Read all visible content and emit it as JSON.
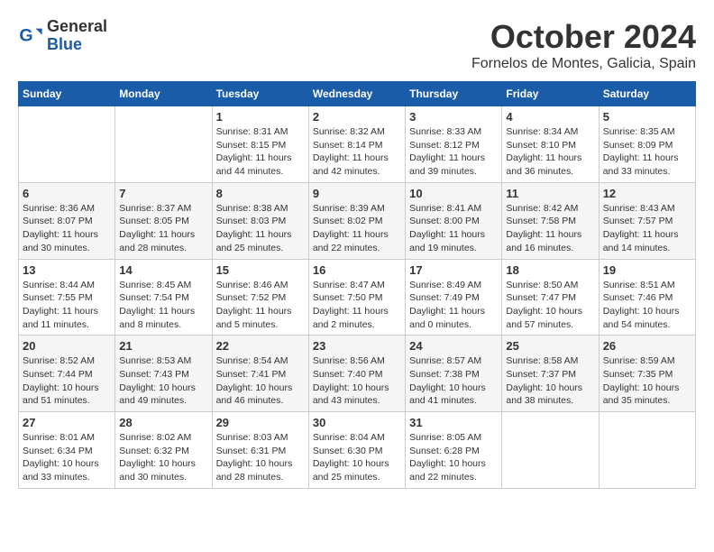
{
  "header": {
    "logo_general": "General",
    "logo_blue": "Blue",
    "month": "October 2024",
    "location": "Fornelos de Montes, Galicia, Spain"
  },
  "weekdays": [
    "Sunday",
    "Monday",
    "Tuesday",
    "Wednesday",
    "Thursday",
    "Friday",
    "Saturday"
  ],
  "weeks": [
    [
      null,
      null,
      {
        "day": 1,
        "sunrise": "8:31 AM",
        "sunset": "8:15 PM",
        "daylight": "11 hours and 44 minutes."
      },
      {
        "day": 2,
        "sunrise": "8:32 AM",
        "sunset": "8:14 PM",
        "daylight": "11 hours and 42 minutes."
      },
      {
        "day": 3,
        "sunrise": "8:33 AM",
        "sunset": "8:12 PM",
        "daylight": "11 hours and 39 minutes."
      },
      {
        "day": 4,
        "sunrise": "8:34 AM",
        "sunset": "8:10 PM",
        "daylight": "11 hours and 36 minutes."
      },
      {
        "day": 5,
        "sunrise": "8:35 AM",
        "sunset": "8:09 PM",
        "daylight": "11 hours and 33 minutes."
      }
    ],
    [
      {
        "day": 6,
        "sunrise": "8:36 AM",
        "sunset": "8:07 PM",
        "daylight": "11 hours and 30 minutes."
      },
      {
        "day": 7,
        "sunrise": "8:37 AM",
        "sunset": "8:05 PM",
        "daylight": "11 hours and 28 minutes."
      },
      {
        "day": 8,
        "sunrise": "8:38 AM",
        "sunset": "8:03 PM",
        "daylight": "11 hours and 25 minutes."
      },
      {
        "day": 9,
        "sunrise": "8:39 AM",
        "sunset": "8:02 PM",
        "daylight": "11 hours and 22 minutes."
      },
      {
        "day": 10,
        "sunrise": "8:41 AM",
        "sunset": "8:00 PM",
        "daylight": "11 hours and 19 minutes."
      },
      {
        "day": 11,
        "sunrise": "8:42 AM",
        "sunset": "7:58 PM",
        "daylight": "11 hours and 16 minutes."
      },
      {
        "day": 12,
        "sunrise": "8:43 AM",
        "sunset": "7:57 PM",
        "daylight": "11 hours and 14 minutes."
      }
    ],
    [
      {
        "day": 13,
        "sunrise": "8:44 AM",
        "sunset": "7:55 PM",
        "daylight": "11 hours and 11 minutes."
      },
      {
        "day": 14,
        "sunrise": "8:45 AM",
        "sunset": "7:54 PM",
        "daylight": "11 hours and 8 minutes."
      },
      {
        "day": 15,
        "sunrise": "8:46 AM",
        "sunset": "7:52 PM",
        "daylight": "11 hours and 5 minutes."
      },
      {
        "day": 16,
        "sunrise": "8:47 AM",
        "sunset": "7:50 PM",
        "daylight": "11 hours and 2 minutes."
      },
      {
        "day": 17,
        "sunrise": "8:49 AM",
        "sunset": "7:49 PM",
        "daylight": "11 hours and 0 minutes."
      },
      {
        "day": 18,
        "sunrise": "8:50 AM",
        "sunset": "7:47 PM",
        "daylight": "10 hours and 57 minutes."
      },
      {
        "day": 19,
        "sunrise": "8:51 AM",
        "sunset": "7:46 PM",
        "daylight": "10 hours and 54 minutes."
      }
    ],
    [
      {
        "day": 20,
        "sunrise": "8:52 AM",
        "sunset": "7:44 PM",
        "daylight": "10 hours and 51 minutes."
      },
      {
        "day": 21,
        "sunrise": "8:53 AM",
        "sunset": "7:43 PM",
        "daylight": "10 hours and 49 minutes."
      },
      {
        "day": 22,
        "sunrise": "8:54 AM",
        "sunset": "7:41 PM",
        "daylight": "10 hours and 46 minutes."
      },
      {
        "day": 23,
        "sunrise": "8:56 AM",
        "sunset": "7:40 PM",
        "daylight": "10 hours and 43 minutes."
      },
      {
        "day": 24,
        "sunrise": "8:57 AM",
        "sunset": "7:38 PM",
        "daylight": "10 hours and 41 minutes."
      },
      {
        "day": 25,
        "sunrise": "8:58 AM",
        "sunset": "7:37 PM",
        "daylight": "10 hours and 38 minutes."
      },
      {
        "day": 26,
        "sunrise": "8:59 AM",
        "sunset": "7:35 PM",
        "daylight": "10 hours and 35 minutes."
      }
    ],
    [
      {
        "day": 27,
        "sunrise": "8:01 AM",
        "sunset": "6:34 PM",
        "daylight": "10 hours and 33 minutes."
      },
      {
        "day": 28,
        "sunrise": "8:02 AM",
        "sunset": "6:32 PM",
        "daylight": "10 hours and 30 minutes."
      },
      {
        "day": 29,
        "sunrise": "8:03 AM",
        "sunset": "6:31 PM",
        "daylight": "10 hours and 28 minutes."
      },
      {
        "day": 30,
        "sunrise": "8:04 AM",
        "sunset": "6:30 PM",
        "daylight": "10 hours and 25 minutes."
      },
      {
        "day": 31,
        "sunrise": "8:05 AM",
        "sunset": "6:28 PM",
        "daylight": "10 hours and 22 minutes."
      },
      null,
      null
    ]
  ]
}
